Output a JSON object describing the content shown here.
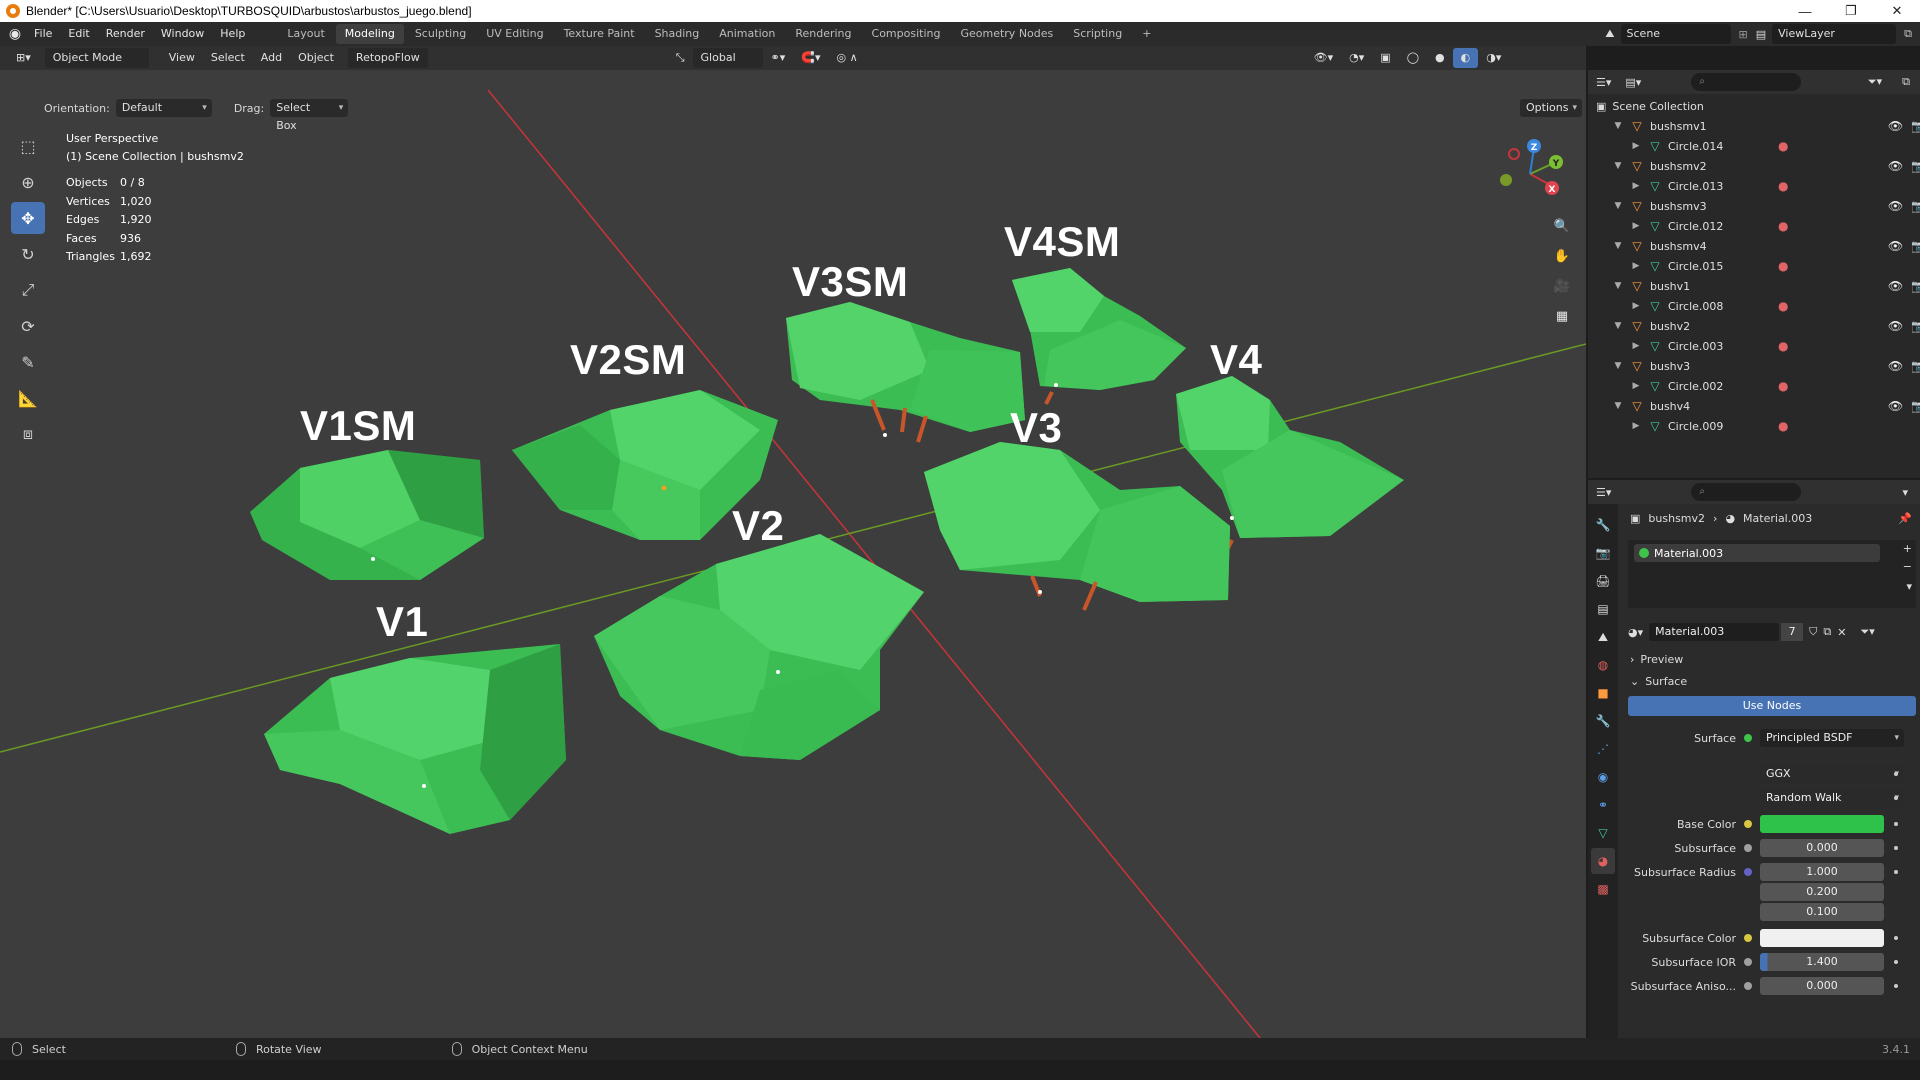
{
  "window": {
    "title": "Blender* [C:\\Users\\Usuario\\Desktop\\TURBOSQUID\\arbustos\\arbustos_juego.blend]",
    "minimize": "—",
    "restore": "❐",
    "close": "✕"
  },
  "menu": {
    "items": [
      "File",
      "Edit",
      "Render",
      "Window",
      "Help"
    ],
    "workspaces": [
      "Layout",
      "Modeling",
      "Sculpting",
      "UV Editing",
      "Texture Paint",
      "Shading",
      "Animation",
      "Rendering",
      "Compositing",
      "Geometry Nodes",
      "Scripting"
    ],
    "active_workspace": "Modeling",
    "add_tab": "+",
    "scene": "Scene",
    "view_layer": "ViewLayer"
  },
  "viewport_header": {
    "mode": "Object Mode",
    "menus": [
      "View",
      "Select",
      "Add",
      "Object"
    ],
    "addon": "RetopoFlow",
    "transform": "Global"
  },
  "tool_settings": {
    "orientation_label": "Orientation:",
    "orientation_value": "Default",
    "drag_label": "Drag:",
    "drag_value": "Select Box",
    "options": "Options"
  },
  "overlay": {
    "perspective": "User Perspective",
    "collection": "(1) Scene Collection | bushsmv2",
    "stats": [
      {
        "k": "Objects",
        "v": "0 / 8"
      },
      {
        "k": "Vertices",
        "v": "1,020"
      },
      {
        "k": "Edges",
        "v": "1,920"
      },
      {
        "k": "Faces",
        "v": "936"
      },
      {
        "k": "Triangles",
        "v": "1,692"
      }
    ]
  },
  "bush_labels": {
    "v1sm": "V1SM",
    "v2sm": "V2SM",
    "v3sm": "V3SM",
    "v4sm": "V4SM",
    "v1": "V1",
    "v2": "V2",
    "v3": "V3",
    "v4": "V4"
  },
  "gizmo": {
    "x": "X",
    "y": "Y",
    "z": "Z"
  },
  "outliner": {
    "root": "Scene Collection",
    "objects": [
      {
        "name": "bushsmv1",
        "mesh": "Circle.014"
      },
      {
        "name": "bushsmv2",
        "mesh": "Circle.013"
      },
      {
        "name": "bushsmv3",
        "mesh": "Circle.012"
      },
      {
        "name": "bushsmv4",
        "mesh": "Circle.015"
      },
      {
        "name": "bushv1",
        "mesh": "Circle.008"
      },
      {
        "name": "bushv2",
        "mesh": "Circle.003"
      },
      {
        "name": "bushv3",
        "mesh": "Circle.002"
      },
      {
        "name": "bushv4",
        "mesh": "Circle.009"
      }
    ]
  },
  "properties": {
    "breadcrumb_object": "bushsmv2",
    "breadcrumb_material": "Material.003",
    "slot": "Material.003",
    "material_name": "Material.003",
    "users": "7",
    "preview": "Preview",
    "surface_section": "Surface",
    "use_nodes": "Use Nodes",
    "rows": {
      "surface_label": "Surface",
      "surface_value": "Principled BSDF",
      "distribution": "GGX",
      "subsurface_method": "Random Walk",
      "base_color_label": "Base Color",
      "base_color": "#2ec24a",
      "subsurface_label": "Subsurface",
      "subsurface": "0.000",
      "radius_label": "Subsurface Radius",
      "radius": [
        "1.000",
        "0.200",
        "0.100"
      ],
      "ss_color_label": "Subsurface Color",
      "ss_color": "#f0f0f0",
      "ior_label": "Subsurface IOR",
      "ior": "1.400",
      "aniso_label": "Subsurface Aniso...",
      "aniso": "0.000"
    }
  },
  "statusbar": {
    "select": "Select",
    "rotate": "Rotate View",
    "context": "Object Context Menu",
    "version": "3.4.1"
  },
  "colors": {
    "accent": "#4772b3",
    "bush_light": "#4fd166",
    "bush_mid": "#33b34a",
    "bush_dark": "#2a9a3d",
    "trunk": "#c9562a",
    "x_axis": "#c8343a",
    "y_axis": "#6a9a24"
  }
}
